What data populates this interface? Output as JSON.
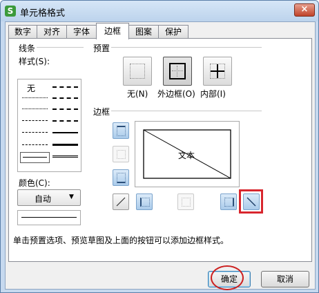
{
  "window": {
    "title": "单元格格式",
    "app_icon_letter": "S",
    "close_label": "×"
  },
  "tabs": [
    {
      "label": "数字",
      "active": false
    },
    {
      "label": "对齐",
      "active": false
    },
    {
      "label": "字体",
      "active": false
    },
    {
      "label": "边框",
      "active": true
    },
    {
      "label": "图案",
      "active": false
    },
    {
      "label": "保护",
      "active": false
    }
  ],
  "line": {
    "group_label": "线条",
    "style_label": "样式(S):",
    "none_label": "无",
    "color_label": "颜色(C):",
    "color_value": "自动",
    "color_dropdown_arrow": "▼"
  },
  "presets": {
    "group_label": "预置",
    "items": [
      {
        "label": "无(N)"
      },
      {
        "label": "外边框(O)"
      },
      {
        "label": "内部(I)"
      }
    ]
  },
  "border": {
    "group_label": "边框",
    "preview_text": "文本"
  },
  "hint": "单击预置选项、预览草图及上面的按钮可以添加边框样式。",
  "buttons": {
    "ok": "确定",
    "cancel": "取消"
  },
  "colors": {
    "highlight": "#d8262e",
    "accent": "#4a8bd1",
    "ok_ring": "#cc1f1f"
  }
}
